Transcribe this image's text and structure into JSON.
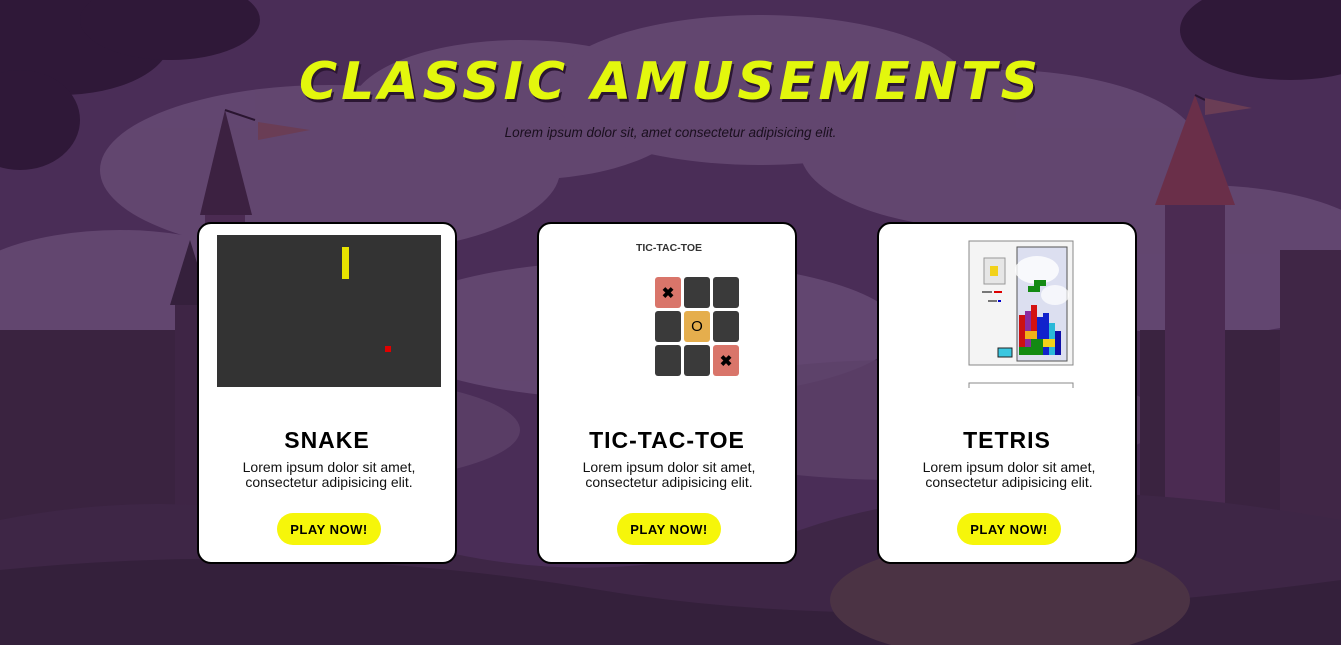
{
  "hero": {
    "title": "CLASSIC AMUSEMENTS",
    "subtitle": "Lorem ipsum dolor sit, amet consectetur adipisicing elit."
  },
  "colors": {
    "background": "#4a2d57",
    "title": "#e3f70d",
    "button": "#f6f60a",
    "card": "#ffffff"
  },
  "cards": [
    {
      "name": "SNAKE",
      "description": "Lorem ipsum dolor sit amet, consectetur adipisicing elit.",
      "button": "PLAY NOW!",
      "thumbnail": "snake-game-preview"
    },
    {
      "name": "TIC-TAC-TOE",
      "description": "Lorem ipsum dolor sit amet, consectetur adipisicing elit.",
      "button": "PLAY NOW!",
      "thumbnail": "tic-tac-toe-preview",
      "preview_title": "TIC-TAC-TOE",
      "board": [
        "X",
        "",
        "",
        "",
        "O",
        "",
        "",
        "",
        "X"
      ]
    },
    {
      "name": "TETRIS",
      "description": "Lorem ipsum dolor sit amet, consectetur adipisicing elit.",
      "button": "PLAY NOW!",
      "thumbnail": "tetris-game-preview"
    }
  ]
}
